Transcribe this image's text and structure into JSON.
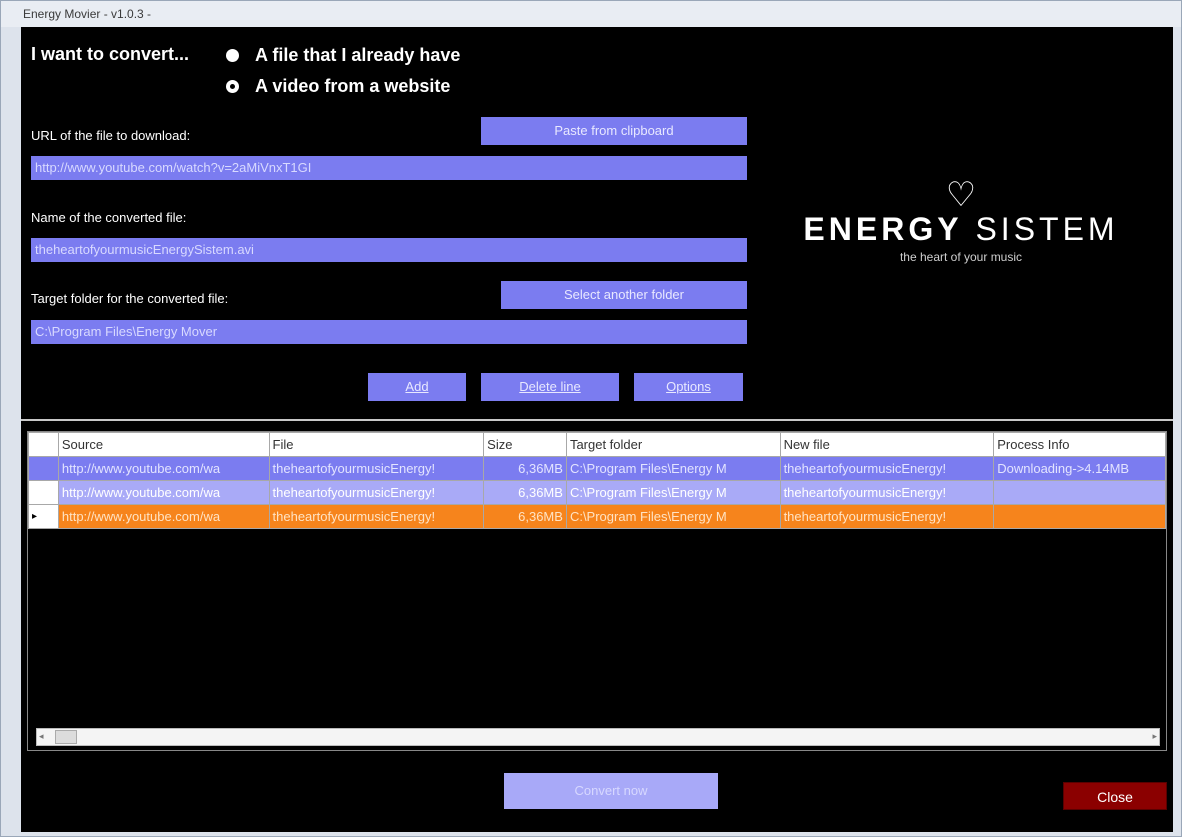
{
  "window": {
    "title": "Energy Movier - v1.0.3 -"
  },
  "convert": {
    "label": "I want to convert...",
    "options": [
      {
        "label": "A file that I already have",
        "checked": false
      },
      {
        "label": "A video from a website",
        "checked": true
      }
    ]
  },
  "url": {
    "label": "URL of the file to download:",
    "value": "http://www.youtube.com/watch?v=2aMiVnxT1GI",
    "paste_button": "Paste from clipboard"
  },
  "name": {
    "label": "Name of the converted file:",
    "value": "theheartofyourmusicEnergySistem.avi"
  },
  "folder": {
    "label": "Target folder for the converted file:",
    "value": "C:\\Program Files\\Energy Mover",
    "select_button": "Select another folder"
  },
  "actions": {
    "add": "Add",
    "delete": "Delete line",
    "options": "Options"
  },
  "logo": {
    "brand_bold": "ENERGY",
    "brand_light": "SISTEM",
    "tagline": "the heart of your music",
    "icon": "heart-icon"
  },
  "table": {
    "columns": [
      "Source",
      "File",
      "Size",
      "Target folder",
      "New file",
      "Process Info"
    ],
    "rows": [
      [
        "http://www.youtube.com/wa",
        "theheartofyourmusicEnergy!",
        "6,36MB",
        "C:\\Program Files\\Energy M",
        "theheartofyourmusicEnergy!",
        "Downloading->4.14MB"
      ],
      [
        "http://www.youtube.com/wa",
        "theheartofyourmusicEnergy!",
        "6,36MB",
        "C:\\Program Files\\Energy M",
        "theheartofyourmusicEnergy!",
        ""
      ],
      [
        "http://www.youtube.com/wa",
        "theheartofyourmusicEnergy!",
        "6,36MB",
        "C:\\Program Files\\Energy M",
        "theheartofyourmusicEnergy!",
        ""
      ]
    ],
    "current_row_marker": "▸"
  },
  "footer": {
    "convert_button": "Convert now",
    "close_button": "Close"
  },
  "colors": {
    "accent": "#7b7cf0",
    "highlight": "#f6841c",
    "close": "#8b0000"
  }
}
